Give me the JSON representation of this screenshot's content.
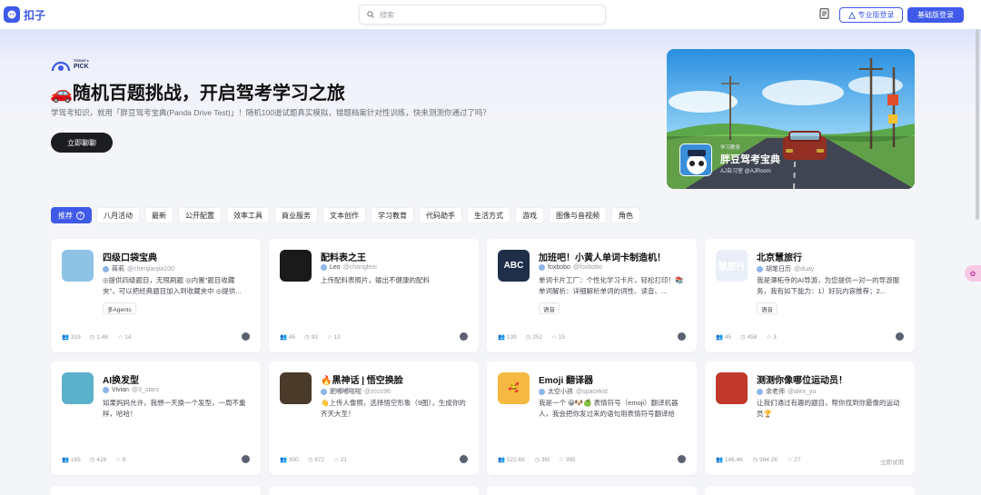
{
  "header": {
    "logo_text": "扣子",
    "search_placeholder": "搜索",
    "pro_login": "专业版登录",
    "basic_login": "基础版登录"
  },
  "hero": {
    "pick_badge_top": "TODAY's",
    "pick_badge": "PICK",
    "title": "🚗随机百题挑战，开启驾考学习之旅",
    "subtitle": "学驾考知识，就用「胖豆驾考宝典(Panda Drive Test)」！随机100道试题真实模拟，错题档案针对性训练，快来测测你通过了吗？",
    "cta": "立即聊聊",
    "banner": {
      "tag": "学习教育",
      "title": "胖豆驾考宝典",
      "author": "AJ自习室 @AJRoom"
    }
  },
  "tabs": [
    {
      "label": "推荐",
      "active": true
    },
    {
      "label": "八月活动"
    },
    {
      "label": "最新"
    },
    {
      "label": "公开配置"
    },
    {
      "label": "效率工具"
    },
    {
      "label": "商业服务"
    },
    {
      "label": "文本创作"
    },
    {
      "label": "学习教育"
    },
    {
      "label": "代码助手"
    },
    {
      "label": "生活方式"
    },
    {
      "label": "游戏"
    },
    {
      "label": "图像与音视频"
    },
    {
      "label": "角色"
    }
  ],
  "cards": [
    {
      "title": "四级口袋宝典",
      "author": "蒋莉",
      "handle": "@chenjianjia100",
      "desc": "◎提供四级题目，无限刷题 ◎内置\"题目收藏夹\"，可以把经典题目加入到收藏夹中 ◎提供...",
      "badge": "多Agents",
      "users": "319",
      "chats": "1.4K",
      "stars": "14",
      "icon_color": "#8ec3e6"
    },
    {
      "title": "配料表之王",
      "author": "Leo",
      "handle": "@changleoi",
      "desc": "上传配料表照片，输出不健康的配料",
      "badge": "",
      "users": "45",
      "chats": "93",
      "stars": "13",
      "icon_color": "#1a1a1a"
    },
    {
      "title": "加班吧！小黄人单词卡制造机！",
      "author": "foxbobo",
      "handle": "@foxbobo",
      "desc": "单词卡片工厂：个性化学习卡片，轻松打印！📚 单词解析：详细解析单词的词性、读音、...",
      "badge": "语音",
      "users": "139",
      "chats": "251",
      "stars": "15",
      "icon_color": "#1f2f4a",
      "icon_text": "ABC"
    },
    {
      "title": "北京慧旅行",
      "author": "胡笔日历",
      "handle": "@duay",
      "desc": "我是潭柘寺的AI导游，为您提供一对一的导游服务，我有如下能力：1）好玩内容推荐；2...",
      "badge": "语音",
      "users": "45",
      "chats": "458",
      "stars": "3",
      "icon_color": "#e9eef8",
      "icon_text": "慧旅行"
    },
    {
      "title": "AI换发型",
      "author": "Vivian",
      "handle": "@3_stars",
      "desc": "如果妈妈允许，我想一天换一个发型，一周不重样，哈哈！",
      "badge": "",
      "users": "165",
      "chats": "428",
      "stars": "9",
      "icon_color": "#5ab1c9"
    },
    {
      "title": "🔥黑神话 | 悟空换脸",
      "author": "肥嘟嘟啦啦",
      "handle": "@zccc96",
      "desc": "👋上传人像照，选择悟空形象（9图），生成你的齐天大圣！",
      "badge": "",
      "users": "300",
      "chats": "872",
      "stars": "21",
      "icon_color": "#4a3a2a"
    },
    {
      "title": "Emoji 翻译器",
      "author": "太空小孩",
      "handle": "@spacekid",
      "desc": "我是一个 😀🐶🍏 表情符号（emoji）翻译机器人，我会把你发过来的语句用表情符号翻译给你。也可以翻译你发过来的表情符号，以...",
      "badge": "",
      "users": "522.6K",
      "chats": "3M",
      "stars": "395",
      "icon_color": "#f5b941",
      "icon_text": "🥰"
    },
    {
      "title": "测测你像哪位运动员！",
      "author": "余老师",
      "handle": "@alex_yu",
      "desc": "让我们通过有趣的题目，帮你找到你最像的运动员🏆",
      "badge": "",
      "users": "146.4K",
      "chats": "994.2K",
      "stars": "27",
      "icon_color": "#c0392b",
      "try_label": "立即试用"
    }
  ]
}
